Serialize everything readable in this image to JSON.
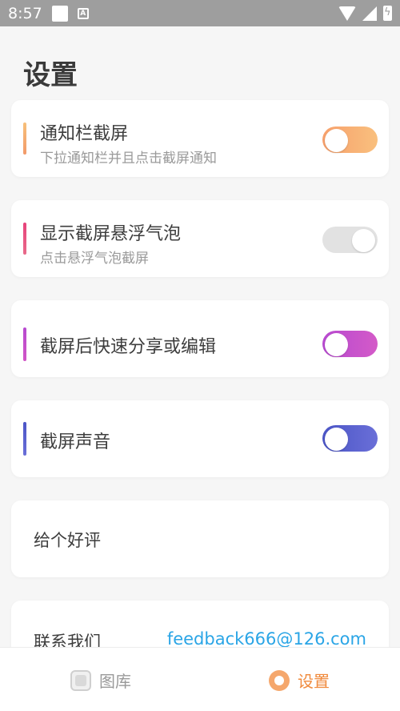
{
  "status_bar": {
    "time": "8:57"
  },
  "page": {
    "title": "设置"
  },
  "settings": [
    {
      "title": "通知栏截屏",
      "subtitle": "下拉通知栏并且点击截屏通知",
      "enabled": true,
      "accent": "#f5a76c"
    },
    {
      "title": "显示截屏悬浮气泡",
      "subtitle": "点击悬浮气泡截屏",
      "enabled": false,
      "accent": "#e05a7a"
    },
    {
      "title": "截屏后快速分享或编辑",
      "subtitle": "",
      "enabled": true,
      "accent": "#c254c9"
    },
    {
      "title": "截屏声音",
      "subtitle": "",
      "enabled": true,
      "accent": "#5a5fcf"
    }
  ],
  "rate": {
    "label": "给个好评"
  },
  "contact": {
    "label": "联系我们",
    "email": "feedback666@126.com"
  },
  "bottom_nav": {
    "gallery_label": "图库",
    "settings_label": "设置",
    "active_color": "#f08a3c",
    "inactive_color": "#9a9a9a"
  }
}
